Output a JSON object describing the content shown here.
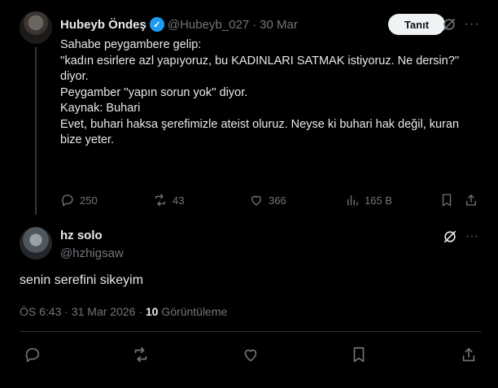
{
  "quoted_post": {
    "author_name": "Hubeyb Öndeş",
    "verified_mark": "✓",
    "handle": "@Hubeyb_027",
    "separator": "·",
    "date": "30 Mar",
    "follow_label": "Tanıt",
    "more_label": "···",
    "text_lines": [
      "Sahabe peygambere gelip:",
      "''kadın esirlere azl yapıyoruz, bu KADINLARI SATMAK istiyoruz. Ne dersin?''",
      "diyor.",
      "Peygamber ''yapın sorun yok'' diyor.",
      "",
      "Kaynak: Buhari",
      "",
      "Evet, buhari haksa şerefimizle ateist oluruz. Neyse ki buhari hak değil, kuran",
      "bize yeter."
    ],
    "stats": {
      "replies": "250",
      "reposts": "43",
      "likes": "366",
      "views": "165 B"
    },
    "icons": [
      "avatar",
      "verified-icon",
      "grok-icon",
      "more-icon",
      "reply-icon",
      "repost-icon",
      "like-icon",
      "views-icon",
      "bookmark-icon",
      "share-icon"
    ]
  },
  "reply_post": {
    "author_name": "hz solo",
    "handle": "@hzhigsaw",
    "more_label": "···",
    "text": "senin serefini sikeyim",
    "time": "ÖS 6:43",
    "separator": "·",
    "date": "31 Mar 2026",
    "separator2": "·",
    "views_count": "10",
    "views_label": "Görüntüleme"
  },
  "colors": {
    "background": "#000000",
    "text": "#e7e9ea",
    "muted": "#71767b",
    "verified": "#1d9bf0",
    "divider": "#2f3336"
  }
}
